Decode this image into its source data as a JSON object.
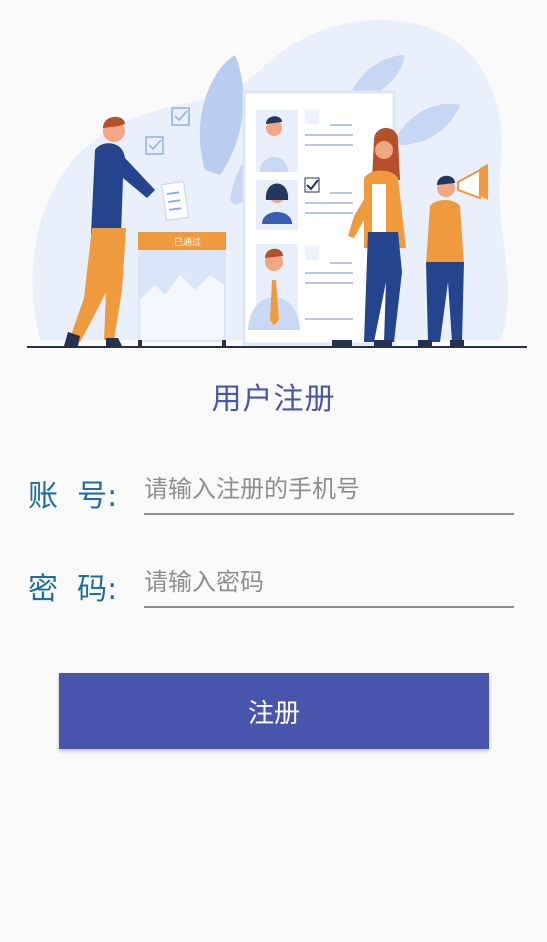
{
  "hero": {
    "ballot_box_label": "已通过"
  },
  "page": {
    "title": "用户注册"
  },
  "form": {
    "account": {
      "label": "账  号:",
      "value": "",
      "placeholder": "请输入注册的手机号"
    },
    "password": {
      "label": "密  码:",
      "value": "",
      "placeholder": "请输入密码"
    },
    "submit_label": "注册"
  },
  "colors": {
    "accent": "#4755ad",
    "label": "#1e6fa0",
    "title": "#4a56a8",
    "orange": "#f09a3e",
    "navy": "#24448e"
  }
}
